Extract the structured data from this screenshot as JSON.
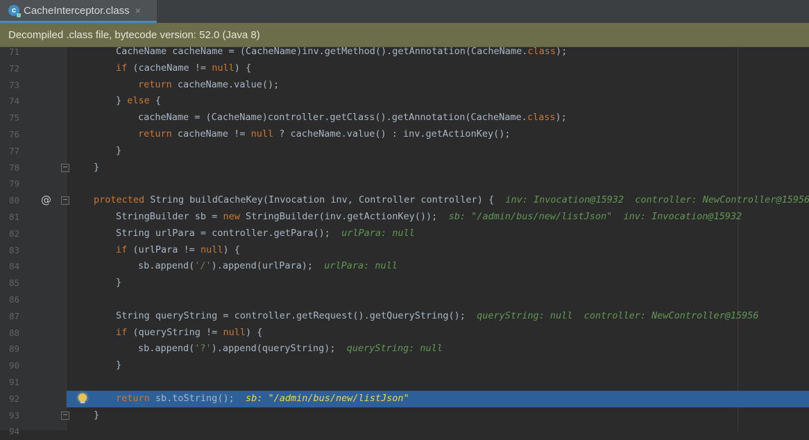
{
  "tab": {
    "label": "CacheInterceptor.class",
    "close": "×",
    "icon_letter": "c"
  },
  "banner": {
    "text": "Decompiled .class file, bytecode version: 52.0 (Java 8)"
  },
  "lines": [
    {
      "no": "71",
      "indent": 1,
      "tokens": [
        [
          "t",
          "CacheName cacheName = (CacheName)inv.getMethod().getAnnotation(CacheName."
        ],
        [
          "k",
          "class"
        ],
        [
          "t",
          ");"
        ]
      ]
    },
    {
      "no": "72",
      "indent": 1,
      "tokens": [
        [
          "k",
          "if"
        ],
        [
          "t",
          " (cacheName != "
        ],
        [
          "k",
          "null"
        ],
        [
          "t",
          ") {"
        ]
      ]
    },
    {
      "no": "73",
      "indent": 2,
      "tokens": [
        [
          "k",
          "return"
        ],
        [
          "t",
          " cacheName.value();"
        ]
      ]
    },
    {
      "no": "74",
      "indent": 1,
      "tokens": [
        [
          "t",
          "} "
        ],
        [
          "k",
          "else"
        ],
        [
          "t",
          " {"
        ]
      ]
    },
    {
      "no": "75",
      "indent": 2,
      "tokens": [
        [
          "t",
          "cacheName = (CacheName)controller.getClass().getAnnotation(CacheName."
        ],
        [
          "k",
          "class"
        ],
        [
          "t",
          ");"
        ]
      ]
    },
    {
      "no": "76",
      "indent": 2,
      "tokens": [
        [
          "k",
          "return"
        ],
        [
          "t",
          " cacheName != "
        ],
        [
          "k",
          "null"
        ],
        [
          "t",
          " ? cacheName.value() : inv.getActionKey();"
        ]
      ]
    },
    {
      "no": "77",
      "indent": 1,
      "tokens": [
        [
          "t",
          "}"
        ]
      ]
    },
    {
      "no": "78",
      "indent": 0,
      "tokens": [
        [
          "t",
          "}"
        ]
      ]
    },
    {
      "no": "79",
      "indent": 0,
      "tokens": []
    },
    {
      "no": "80",
      "indent": 0,
      "tokens": [
        [
          "k",
          "protected"
        ],
        [
          "t",
          " String buildCacheKey(Invocation inv, Controller controller) {  "
        ],
        [
          "h",
          "inv: Invocation@15932  controller: NewController@15956"
        ]
      ]
    },
    {
      "no": "81",
      "indent": 1,
      "tokens": [
        [
          "t",
          "StringBuilder sb = "
        ],
        [
          "k",
          "new"
        ],
        [
          "t",
          " StringBuilder(inv.getActionKey());  "
        ],
        [
          "h",
          "sb: \"/admin/bus/new/listJson\"  inv: Invocation@15932"
        ]
      ]
    },
    {
      "no": "82",
      "indent": 1,
      "tokens": [
        [
          "t",
          "String urlPara = controller.getPara();  "
        ],
        [
          "h",
          "urlPara: null"
        ]
      ]
    },
    {
      "no": "83",
      "indent": 1,
      "tokens": [
        [
          "k",
          "if"
        ],
        [
          "t",
          " (urlPara != "
        ],
        [
          "k",
          "null"
        ],
        [
          "t",
          ") {"
        ]
      ]
    },
    {
      "no": "84",
      "indent": 2,
      "tokens": [
        [
          "t",
          "sb.append("
        ],
        [
          "s",
          "'/'"
        ],
        [
          "t",
          ").append(urlPara);  "
        ],
        [
          "h",
          "urlPara: null"
        ]
      ]
    },
    {
      "no": "85",
      "indent": 1,
      "tokens": [
        [
          "t",
          "}"
        ]
      ]
    },
    {
      "no": "86",
      "indent": 0,
      "tokens": []
    },
    {
      "no": "87",
      "indent": 1,
      "tokens": [
        [
          "t",
          "String queryString = controller.getRequest().getQueryString();  "
        ],
        [
          "h",
          "queryString: null  controller: NewController@15956"
        ]
      ]
    },
    {
      "no": "88",
      "indent": 1,
      "tokens": [
        [
          "k",
          "if"
        ],
        [
          "t",
          " (queryString != "
        ],
        [
          "k",
          "null"
        ],
        [
          "t",
          ") {"
        ]
      ]
    },
    {
      "no": "89",
      "indent": 2,
      "tokens": [
        [
          "t",
          "sb.append("
        ],
        [
          "s",
          "'?'"
        ],
        [
          "t",
          ").append(queryString);  "
        ],
        [
          "h",
          "queryString: null"
        ]
      ]
    },
    {
      "no": "90",
      "indent": 1,
      "tokens": [
        [
          "t",
          "}"
        ]
      ]
    },
    {
      "no": "91",
      "indent": 0,
      "tokens": []
    },
    {
      "no": "92",
      "indent": 1,
      "highlight": true,
      "tokens": [
        [
          "k",
          "return"
        ],
        [
          "t",
          " sb.toString();  "
        ],
        [
          "h",
          "sb: \"/admin/bus/new/listJson\""
        ]
      ]
    },
    {
      "no": "93",
      "indent": 0,
      "tokens": [
        [
          "t",
          "}"
        ]
      ]
    },
    {
      "no": "94",
      "indent": 0,
      "tokens": []
    }
  ],
  "gutter_icons": {
    "override": "@"
  },
  "colors": {
    "background": "#2b2b2b",
    "keyword": "#cc7832",
    "inline_hint": "#629755",
    "execution_line": "#2d5f99",
    "banner": "#6c6d4b"
  }
}
